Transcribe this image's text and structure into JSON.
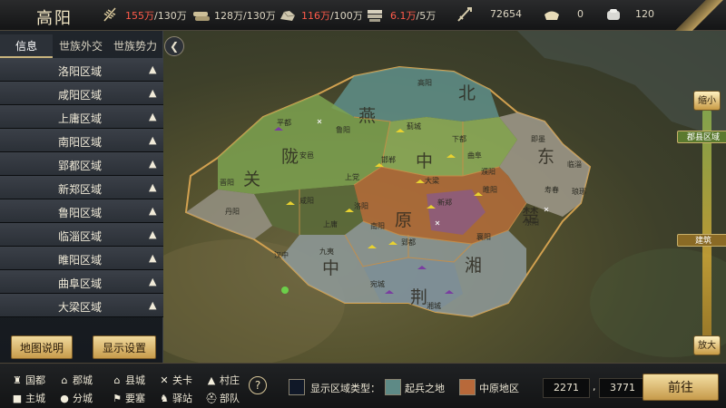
{
  "city_name": "高阳",
  "resources": [
    {
      "icon": "grain-icon",
      "current": "155万",
      "max": "/130万",
      "warn": true
    },
    {
      "icon": "wood-icon",
      "current": "128万",
      "max": "/130万",
      "warn": false
    },
    {
      "icon": "stone-icon",
      "current": "116万",
      "max": "/100万",
      "warn": true
    },
    {
      "icon": "iron-icon",
      "current": "6.1万",
      "max": "/5万",
      "warn": true
    },
    {
      "icon": "troops-icon",
      "current": "72654",
      "max": "",
      "warn": false
    },
    {
      "icon": "gold-icon",
      "current": "0",
      "max": "",
      "warn": false
    },
    {
      "icon": "silver-icon",
      "current": "120",
      "max": "",
      "warn": false
    }
  ],
  "tabs": [
    "信息",
    "世族外交",
    "世族势力"
  ],
  "regions": [
    "洛阳区域",
    "咸阳区域",
    "上庸区域",
    "南阳区域",
    "郢都区域",
    "新郑区域",
    "鲁阳区域",
    "临淄区域",
    "睢阳区域",
    "曲阜区域",
    "大梁区域"
  ],
  "panel_buttons": {
    "map_info": "地图说明",
    "display_settings": "显示设置"
  },
  "map": {
    "big_labels": [
      "北",
      "燕",
      "陇",
      "中",
      "关",
      "东",
      "原",
      "楚",
      "中",
      "湘",
      "荆"
    ],
    "cities": [
      "高阳",
      "平都",
      "鲁阳",
      "蓟城",
      "下都",
      "邯郸",
      "上党",
      "咸阳",
      "洛阳",
      "大梁",
      "新郑",
      "曲阜",
      "临淄",
      "睢阳",
      "上庸",
      "南阳",
      "郢都",
      "湘城",
      "宛城",
      "汉中",
      "即墨",
      "琅琊",
      "寿春",
      "东阳",
      "安邑",
      "晋阳",
      "丹阳",
      "九夷",
      "襄阳",
      "濮阳"
    ]
  },
  "zoom": {
    "top_label": "缩小",
    "bottom_label": "放大",
    "tag_county": "郡县区域",
    "tag_building": "建筑"
  },
  "legend": [
    {
      "icon": "capital-icon",
      "label": "国都"
    },
    {
      "icon": "commandery-icon",
      "label": "郡城"
    },
    {
      "icon": "county-icon",
      "label": "县城"
    },
    {
      "icon": "pass-icon",
      "label": "关卡"
    },
    {
      "icon": "village-icon",
      "label": "村庄"
    },
    {
      "icon": "main-city-icon",
      "label": "主城"
    },
    {
      "icon": "branch-city-icon",
      "label": "分城"
    },
    {
      "icon": "fortress-icon",
      "label": "要塞"
    },
    {
      "icon": "station-icon",
      "label": "驿站"
    },
    {
      "icon": "troop-icon",
      "label": "部队"
    }
  ],
  "display_type": {
    "label": "显示区域类型：",
    "options": [
      {
        "name": "起兵之地",
        "color": "#5e8a86"
      },
      {
        "name": "中原地区",
        "color": "#b8693a"
      }
    ]
  },
  "coords": {
    "x": "2271",
    "y": "3771"
  },
  "go_label": "前往",
  "colors": {
    "accent": "#c9b47d",
    "warn_red": "#ff5a4a"
  }
}
